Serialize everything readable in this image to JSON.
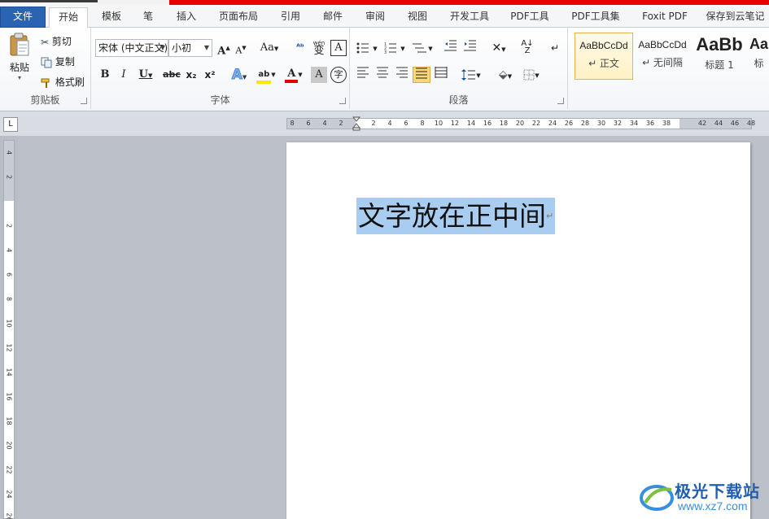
{
  "tabs": [
    {
      "label": "文件",
      "id": "file"
    },
    {
      "label": "开始",
      "id": "home",
      "active": true
    },
    {
      "label": "模板",
      "id": "template"
    },
    {
      "label": "笔",
      "id": "pen"
    },
    {
      "label": "插入",
      "id": "insert"
    },
    {
      "label": "页面布局",
      "id": "layout"
    },
    {
      "label": "引用",
      "id": "references"
    },
    {
      "label": "邮件",
      "id": "mailings"
    },
    {
      "label": "审阅",
      "id": "review"
    },
    {
      "label": "视图",
      "id": "view"
    },
    {
      "label": "开发工具",
      "id": "developer"
    },
    {
      "label": "PDF工具",
      "id": "pdf-tools"
    },
    {
      "label": "PDF工具集",
      "id": "pdf-toolset"
    },
    {
      "label": "Foxit PDF",
      "id": "foxit"
    },
    {
      "label": "保存到云笔记",
      "id": "cloud-note"
    }
  ],
  "clipboard": {
    "paste": "粘贴",
    "cut": "剪切",
    "copy": "复制",
    "format_painter": "格式刷",
    "group_label": "剪贴板"
  },
  "font": {
    "font_name": "宋体 (中文正文)",
    "font_size": "小初",
    "group_label": "字体",
    "grow": "A",
    "shrink": "A",
    "change_case": "Aa",
    "bold": "B",
    "italic": "I",
    "underline": "U",
    "strike": "abc",
    "subscript": "x₂",
    "superscript": "x²",
    "text_effect": "A",
    "font_color": "A",
    "char_shading": "A",
    "enclose": "字",
    "phonetic": "wén",
    "char_border": "A"
  },
  "paragraph": {
    "group_label": "段落"
  },
  "styles": [
    {
      "preview": "AaBbCcDd",
      "name": "↵ 正文",
      "selected": true
    },
    {
      "preview": "AaBbCcDd",
      "name": "↵ 无间隔"
    },
    {
      "preview": "AaBb",
      "name": "标题 1"
    },
    {
      "preview": "Aa",
      "name": "标"
    }
  ],
  "ruler": {
    "horizontal": [
      "8",
      "6",
      "4",
      "2",
      "2",
      "4",
      "6",
      "8",
      "10",
      "12",
      "14",
      "16",
      "18",
      "20",
      "22",
      "24",
      "26",
      "28",
      "30",
      "32",
      "34",
      "36",
      "38",
      "42",
      "44",
      "46",
      "48"
    ],
    "vertical": [
      "4",
      "2",
      "2",
      "4",
      "6",
      "8",
      "10",
      "12",
      "14",
      "16",
      "18",
      "20",
      "22",
      "24",
      "26"
    ]
  },
  "document": {
    "text": "文字放在正中间",
    "paragraph_mark": "↵"
  },
  "watermark": {
    "brand": "极光下载站",
    "url": "www.xz7.com"
  },
  "colors": {
    "accent_blue": "#2b63b3",
    "selection": "#a9cdf0",
    "highlight_yellow": "#ffe800",
    "font_red": "#e00000"
  }
}
